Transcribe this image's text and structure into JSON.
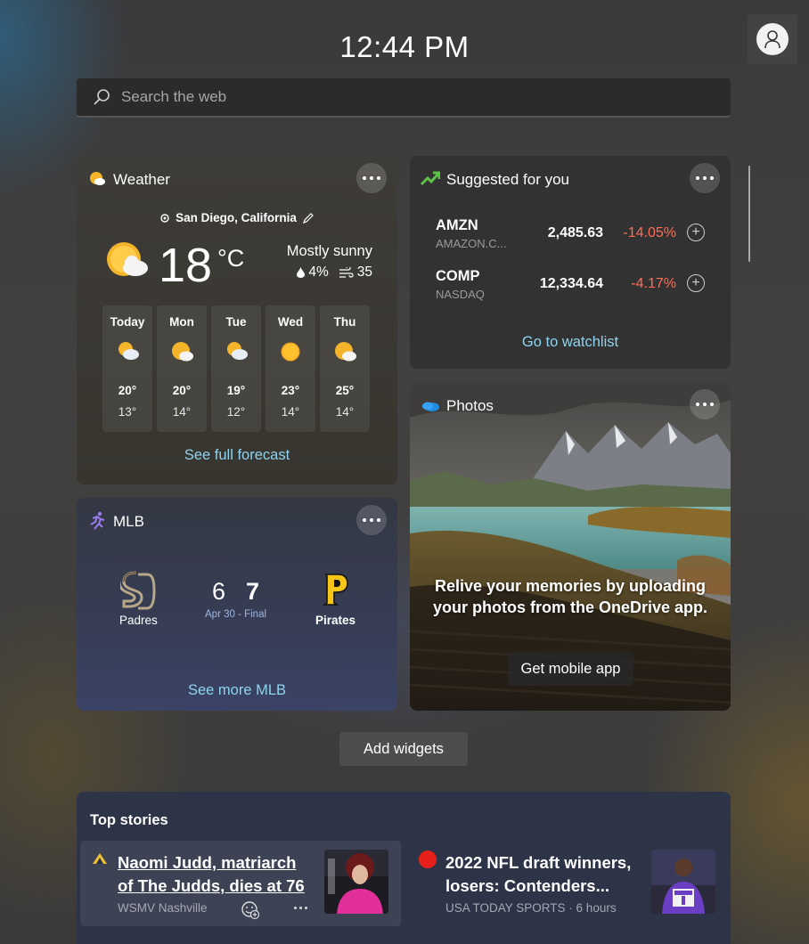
{
  "header": {
    "time": "12:44 PM"
  },
  "search": {
    "placeholder": "Search the web"
  },
  "weather": {
    "title": "Weather",
    "location": "San Diego, California",
    "temperature": "18",
    "unit": "°C",
    "condition": "Mostly sunny",
    "precipitation": "4%",
    "wind": "35",
    "days": [
      {
        "name": "Today",
        "high": "20°",
        "low": "13°",
        "icon": "partly-sunny-icon"
      },
      {
        "name": "Mon",
        "high": "20°",
        "low": "14°",
        "icon": "mostly-sunny-icon"
      },
      {
        "name": "Tue",
        "high": "19°",
        "low": "12°",
        "icon": "partly-sunny-icon"
      },
      {
        "name": "Wed",
        "high": "23°",
        "low": "14°",
        "icon": "sunny-icon"
      },
      {
        "name": "Thu",
        "high": "25°",
        "low": "14°",
        "icon": "mostly-sunny-icon"
      }
    ],
    "link": "See full forecast"
  },
  "stocks": {
    "title": "Suggested for you",
    "items": [
      {
        "symbol": "AMZN",
        "name": "AMAZON.C...",
        "price": "2,485.63",
        "change": "-14.05%"
      },
      {
        "symbol": "COMP",
        "name": "NASDAQ",
        "price": "12,334.64",
        "change": "-4.17%"
      }
    ],
    "link": "Go to watchlist"
  },
  "photos": {
    "title": "Photos",
    "message": "Relive your memories by uploading your photos from the OneDrive app.",
    "button": "Get mobile app"
  },
  "mlb": {
    "title": "MLB",
    "home_team": "Padres",
    "home_score": "6",
    "away_team": "Pirates",
    "away_score": "7",
    "game_info": "Apr 30 - Final",
    "link": "See more MLB"
  },
  "add_widgets": "Add widgets",
  "news": {
    "title": "Top stories",
    "stories": [
      {
        "headline": "Naomi Judd, matriarch of The Judds, dies at 76",
        "source": "WSMV Nashville"
      },
      {
        "headline": "2022 NFL draft winners, losers: Contenders...",
        "source": "USA TODAY SPORTS · 6 hours"
      }
    ]
  },
  "colors": {
    "accent_link": "#8fd3ee",
    "negative": "#ff6d55",
    "score_date": "#9fb7e0"
  }
}
